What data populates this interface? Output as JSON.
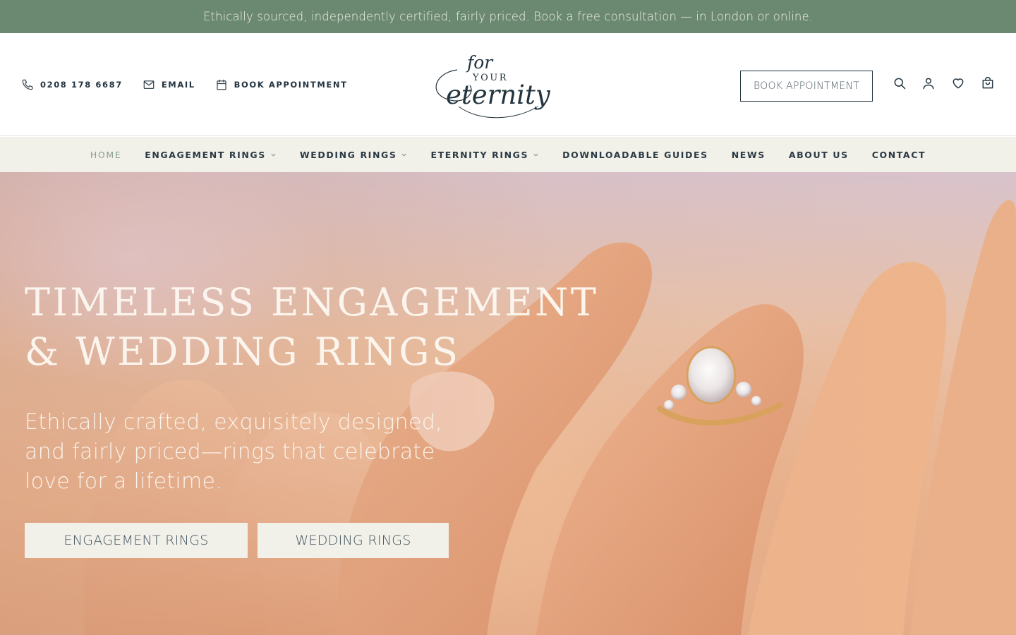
{
  "announcement": {
    "text": "Ethically sourced, independently certified, fairly priced. Book a free consultation — in London or online."
  },
  "header": {
    "contacts": [
      {
        "icon": "phone-icon",
        "label": "0208 178 6687"
      },
      {
        "icon": "mail-icon",
        "label": "EMAIL"
      },
      {
        "icon": "calendar-icon",
        "label": "BOOK APPOINTMENT"
      }
    ],
    "logo": {
      "line1": "for",
      "line2": "YOUR",
      "line3": "eternity"
    },
    "book_button": "BOOK APPOINTMENT",
    "icons": [
      "search-icon",
      "account-icon",
      "wishlist-heart-icon",
      "cart-bag-icon"
    ]
  },
  "nav": {
    "items": [
      {
        "label": "HOME",
        "active": true,
        "dropdown": false
      },
      {
        "label": "ENGAGEMENT RINGS",
        "active": false,
        "dropdown": true
      },
      {
        "label": "WEDDING RINGS",
        "active": false,
        "dropdown": true
      },
      {
        "label": "ETERNITY RINGS",
        "active": false,
        "dropdown": true
      },
      {
        "label": "DOWNLOADABLE GUIDES",
        "active": false,
        "dropdown": false
      },
      {
        "label": "NEWS",
        "active": false,
        "dropdown": false
      },
      {
        "label": "ABOUT US",
        "active": false,
        "dropdown": false
      },
      {
        "label": "CONTACT",
        "active": false,
        "dropdown": false
      }
    ]
  },
  "hero": {
    "title_line1": "TIMELESS ENGAGEMENT",
    "title_line2": "& WEDDING RINGS",
    "subtitle_line1": "Ethically crafted, exquisitely designed,",
    "subtitle_line2": "and fairly priced—rings that celebrate",
    "subtitle_line3": "love for a lifetime.",
    "buttons": [
      "ENGAGEMENT RINGS",
      "WEDDING RINGS"
    ]
  },
  "colors": {
    "announcement_bg": "#6b8870",
    "nav_bg": "#f1f0e9",
    "text_dark": "#23343f",
    "nav_active": "#8a9f8e",
    "hero_button_bg": "#f1f0e9"
  }
}
